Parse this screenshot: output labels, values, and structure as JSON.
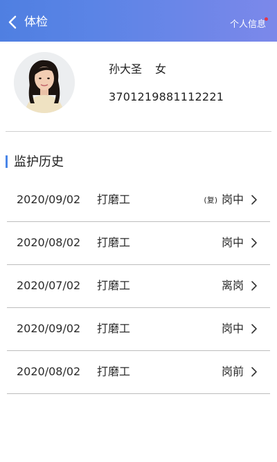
{
  "header": {
    "title": "体检",
    "right_link": "个人信息",
    "back_icon": "chevron-left-icon",
    "gradient_start": "#4f7fe1",
    "gradient_end": "#7c88ea",
    "notify_dot_color": "#e2364a"
  },
  "profile": {
    "name": "孙大圣",
    "gender": "女",
    "id_number": "3701219881112221"
  },
  "section": {
    "title": "监护历史",
    "accent_color": "#4a86e8"
  },
  "history": [
    {
      "date": "2020/09/02",
      "job": "打磨工",
      "tag": "(复)",
      "status": "岗中"
    },
    {
      "date": "2020/08/02",
      "job": "打磨工",
      "tag": "",
      "status": "岗中"
    },
    {
      "date": "2020/07/02",
      "job": "打磨工",
      "tag": "",
      "status": "离岗"
    },
    {
      "date": "2020/09/02",
      "job": "打磨工",
      "tag": "",
      "status": "岗中"
    },
    {
      "date": "2020/08/02",
      "job": "打磨工",
      "tag": "",
      "status": "岗前"
    }
  ]
}
